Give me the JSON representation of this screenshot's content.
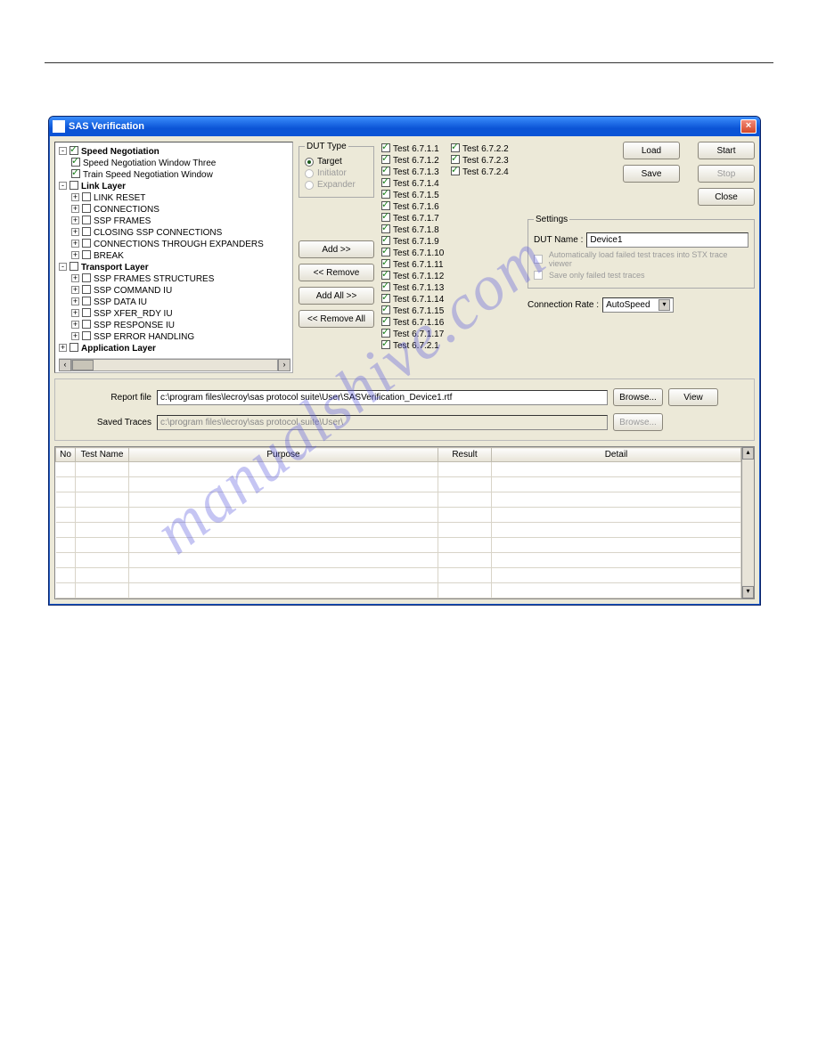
{
  "watermark": "manualshive.com",
  "titlebar": {
    "text": "SAS Verification"
  },
  "tree": {
    "root": [
      {
        "label": "Speed Negotiation",
        "checked": true,
        "bold": true,
        "exp": "-",
        "children": [
          {
            "label": "Speed Negotiation Window Three",
            "checked": true
          },
          {
            "label": "Train Speed Negotiation Window",
            "checked": true
          }
        ]
      },
      {
        "label": "Link Layer",
        "checked": false,
        "bold": true,
        "exp": "-",
        "children": [
          {
            "label": "LINK RESET",
            "checked": false,
            "exp": "+"
          },
          {
            "label": "CONNECTIONS",
            "checked": false,
            "exp": "+"
          },
          {
            "label": "SSP FRAMES",
            "checked": false,
            "exp": "+"
          },
          {
            "label": "CLOSING SSP CONNECTIONS",
            "checked": false,
            "exp": "+"
          },
          {
            "label": "CONNECTIONS THROUGH EXPANDERS",
            "checked": false,
            "exp": "+"
          },
          {
            "label": "BREAK",
            "checked": false,
            "exp": "+"
          }
        ]
      },
      {
        "label": "Transport Layer",
        "checked": false,
        "bold": true,
        "exp": "-",
        "children": [
          {
            "label": "SSP FRAMES STRUCTURES",
            "checked": false,
            "exp": "+"
          },
          {
            "label": "SSP COMMAND IU",
            "checked": false,
            "exp": "+"
          },
          {
            "label": "SSP DATA IU",
            "checked": false,
            "exp": "+"
          },
          {
            "label": "SSP XFER_RDY IU",
            "checked": false,
            "exp": "+"
          },
          {
            "label": "SSP RESPONSE IU",
            "checked": false,
            "exp": "+"
          },
          {
            "label": "SSP ERROR HANDLING",
            "checked": false,
            "exp": "+"
          }
        ]
      },
      {
        "label": "Application Layer",
        "checked": false,
        "bold": true,
        "exp": "+"
      }
    ]
  },
  "dut_type": {
    "legend": "DUT Type",
    "options": [
      {
        "label": "Target",
        "selected": true,
        "enabled": true
      },
      {
        "label": "Initiator",
        "selected": false,
        "enabled": false
      },
      {
        "label": "Expander",
        "selected": false,
        "enabled": false
      }
    ]
  },
  "transfer_buttons": {
    "add": "Add >>",
    "remove": "<< Remove",
    "add_all": "Add All >>",
    "remove_all": "<< Remove All"
  },
  "tests": {
    "col1": [
      "Test 6.7.1.1",
      "Test 6.7.1.2",
      "Test 6.7.1.3",
      "Test 6.7.1.4",
      "Test 6.7.1.5",
      "Test 6.7.1.6",
      "Test 6.7.1.7",
      "Test 6.7.1.8",
      "Test 6.7.1.9",
      "Test 6.7.1.10",
      "Test 6.7.1.11",
      "Test 6.7.1.12",
      "Test 6.7.1.13",
      "Test 6.7.1.14",
      "Test 6.7.1.15",
      "Test 6.7.1.16",
      "Test 6.7.1.17",
      "Test 6.7.2.1"
    ],
    "col2": [
      "Test 6.7.2.2",
      "Test 6.7.2.3",
      "Test 6.7.2.4"
    ]
  },
  "action_buttons": {
    "load": "Load",
    "save": "Save",
    "start": "Start",
    "stop": "Stop",
    "close": "Close"
  },
  "settings": {
    "legend": "Settings",
    "dut_name_label": "DUT Name :",
    "dut_name_value": "Device1",
    "auto_load_label": "Automatically load failed test traces into STX trace viewer",
    "save_failed_label": "Save only failed test traces"
  },
  "connection": {
    "label": "Connection Rate :",
    "value": "AutoSpeed"
  },
  "paths": {
    "report_label": "Report file",
    "report_value": "c:\\program files\\lecroy\\sas protocol suite\\User\\SASVerification_Device1.rtf",
    "traces_label": "Saved Traces",
    "traces_value": "c:\\program files\\lecroy\\sas protocol suite\\User\\",
    "browse": "Browse...",
    "view": "View"
  },
  "grid": {
    "headers": [
      "No",
      "Test Name",
      "Purpose",
      "Result",
      "Detail"
    ]
  }
}
